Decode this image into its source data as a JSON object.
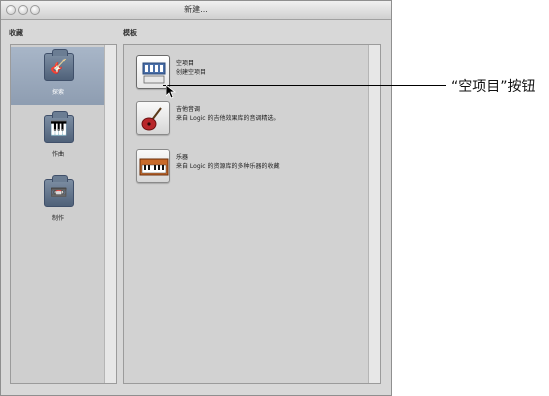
{
  "window": {
    "title": "新建..."
  },
  "sections": {
    "favorites_label": "收藏",
    "templates_label": "模板"
  },
  "sidebar": {
    "items": [
      {
        "label": "探索",
        "icon": "guitar-icon",
        "selected": true
      },
      {
        "label": "作曲",
        "icon": "piano-icon",
        "selected": false
      },
      {
        "label": "制作",
        "icon": "tape-recorder-icon",
        "selected": false
      }
    ]
  },
  "templates": [
    {
      "name": "空项目",
      "desc": "创建空项目",
      "icon": "empty-project-icon"
    },
    {
      "name": "吉他音调",
      "desc": "来自 Logic 的吉他效果库的音调精选。",
      "icon": "guitar-icon"
    },
    {
      "name": "乐器",
      "desc": "来自 Logic 的资源库的多种乐器的收藏",
      "icon": "keyboard-icon"
    }
  ],
  "callout": {
    "text": "“空项目”按钮"
  },
  "colors": {
    "window_bg": "#d8d8d8",
    "selected_item": "#8e9db1"
  }
}
